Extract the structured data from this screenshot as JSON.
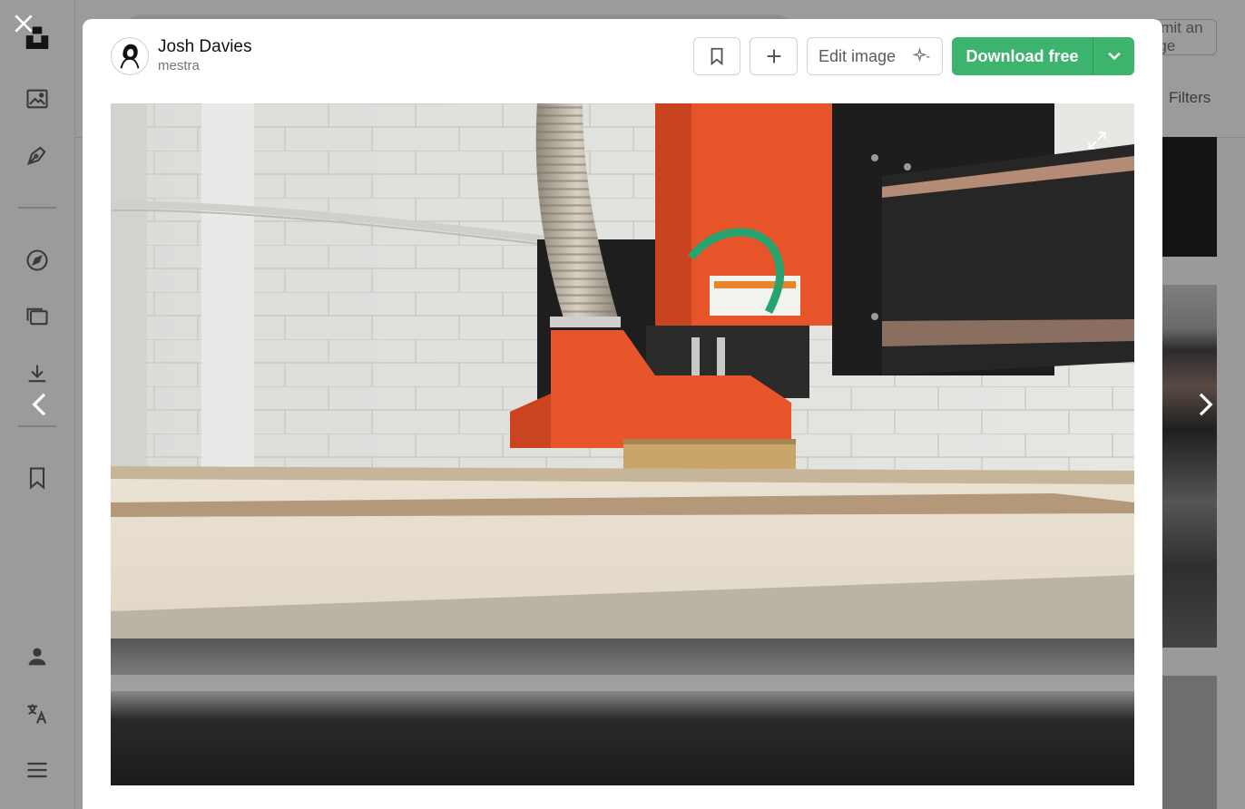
{
  "author": {
    "name": "Josh Davies",
    "handle": "mestra"
  },
  "toolbar": {
    "bookmark_icon": "bookmark-icon",
    "add_icon": "plus-icon",
    "edit_label": "Edit image",
    "download_label": "Download free",
    "download_menu_icon": "chevron-down-icon"
  },
  "background": {
    "submit_label": "Submit an image",
    "filters_label": "Filters"
  },
  "sidebar": {
    "icons": [
      "unsplash-logo-icon",
      "image-icon",
      "pen-nib-icon",
      "compass-icon",
      "collections-icon",
      "download-icon",
      "bookmark-icon",
      "user-icon",
      "translate-icon",
      "menu-icon"
    ]
  },
  "colors": {
    "download_green": "#3cb46e",
    "overlay": "#9a9a9a"
  }
}
